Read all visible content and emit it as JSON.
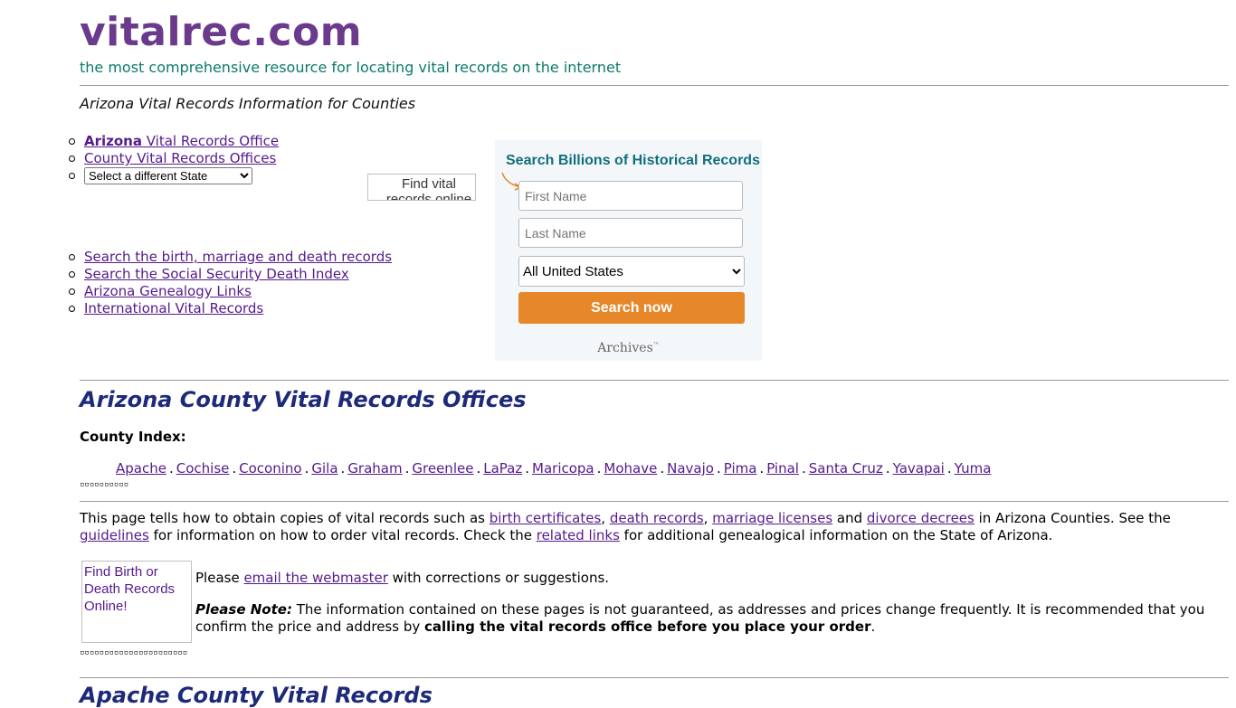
{
  "site": {
    "title": "vitalrec.com",
    "tagline": "the most comprehensive resource for locating vital records on the internet"
  },
  "page_heading": "Arizona Vital Records Information for Counties",
  "nav_top": [
    {
      "bold": "Arizona",
      "text": " Vital Records Office"
    },
    {
      "text": "County Vital Records Offices"
    }
  ],
  "state_select": {
    "selected": "Select a different State"
  },
  "find_vital_img_alt": "Find vital records online",
  "nav_links": [
    "Search the birth, marriage and death records",
    "Search the Social Security Death Index",
    "Arizona Genealogy Links",
    "International Vital Records"
  ],
  "search_widget": {
    "title": "Search Billions of Historical Records",
    "first_name_placeholder": "First Name",
    "last_name_placeholder": "Last Name",
    "location_selected": "All United States",
    "button_label": "Search now",
    "brand": "Archives",
    "brand_tm": "™",
    "accent_color": "#e6872a",
    "title_color": "#116e7d"
  },
  "section_title": "Arizona County Vital Records Offices",
  "county_index_label": "County Index:",
  "counties": [
    "Apache",
    "Cochise",
    "Coconino",
    "Gila",
    "Graham",
    "Greenlee",
    "LaPaz",
    "Maricopa",
    "Mohave",
    "Navajo",
    "Pima",
    "Pinal",
    "Santa Cruz",
    "Yavapai",
    "Yuma"
  ],
  "county_separator": ".",
  "boxes_row1": "▫▫▫▫▫▫▫▫▫▫",
  "boxes_row2": "▫▫▫▫▫▫▫▫▫▫▫▫▫▫▫▫▫▫▫▫▫▫",
  "intro": {
    "t1": "This page tells how to obtain copies of vital records such as ",
    "l1": "birth certificates",
    "t2": ", ",
    "l2": "death records",
    "t3": ", ",
    "l3": "marriage licenses",
    "t4": " and ",
    "l4": "divorce decrees",
    "t5": " in Arizona Counties. See the ",
    "l5": "guidelines",
    "t6": " for information on how to order vital records. Check the ",
    "l6": "related links",
    "t7": " for additional genealogical information on the State of Arizona."
  },
  "death_img_alt": "Find Birth or Death Records Online!",
  "contact": {
    "t1": "Please ",
    "link": "email the webmaster",
    "t2": " with corrections or suggestions."
  },
  "note": {
    "label": "Please Note:",
    "t1": " The information contained on these pages is not guaranteed, as addresses and prices change frequently. It is recommended that you confirm the price and address by ",
    "bold": "calling the vital records office before you place your order",
    "t2": "."
  },
  "next_section_title": "Apache County Vital Records"
}
